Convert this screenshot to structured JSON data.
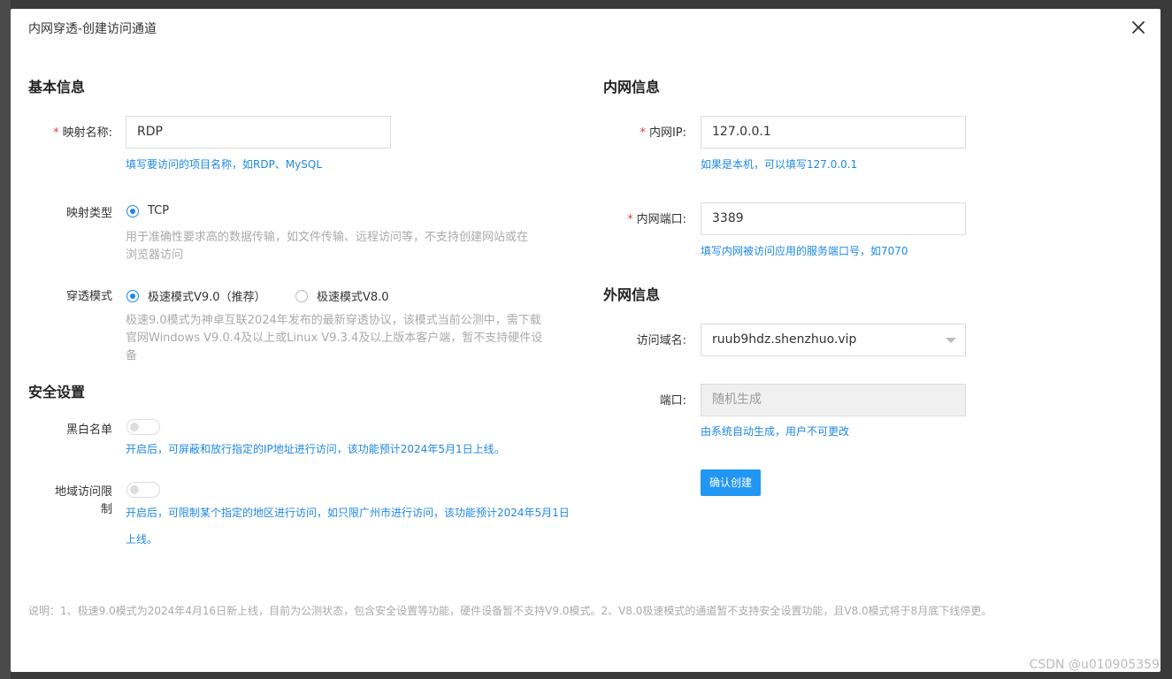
{
  "dialog": {
    "title": "内网穿透-创建访问通道"
  },
  "basic": {
    "section_title": "基本信息",
    "mapping_name_label": "映射名称:",
    "mapping_name_value": "RDP",
    "mapping_name_hint": "填写要访问的项目名称，如RDP、MySQL",
    "mapping_type_label": "映射类型",
    "mapping_type_option": "TCP",
    "mapping_type_desc_line1": "用于准确性要求高的数据传输，如文件传输、远程访问等，不支持创建网站或在",
    "mapping_type_desc_line2": "浏览器访问",
    "mode_label": "穿透模式",
    "mode_option_1": "极速模式V9.0（推荐）",
    "mode_option_2": "极速模式V8.0",
    "mode_selected": "极速模式V9.0（推荐）",
    "mode_desc_line1": "极速9.0模式为神卓互联2024年发布的最新穿透协议，该模式当前公测中，需下载",
    "mode_desc_line2": "官网Windows V9.0.4及以上或Linux V9.3.4及以上版本客户端，暂不支持硬件设",
    "mode_desc_line3": "备"
  },
  "security": {
    "section_title": "安全设置",
    "whitelist_label": "黑白名单",
    "whitelist_enabled": false,
    "whitelist_hint": "开启后，可屏蔽和放行指定的IP地址进行访问，该功能预计2024年5月1日上线。",
    "geo_label_line1": "地域访问限",
    "geo_label_line2": "制",
    "geo_enabled": false,
    "geo_hint_line1": "开启后，可限制某个指定的地区进行访问，如只限广州市进行访问，该功能预计2024年5月1日",
    "geo_hint_line2": "上线。"
  },
  "intranet": {
    "section_title": "内网信息",
    "ip_label": "内网IP:",
    "ip_value": "127.0.0.1",
    "ip_hint": "如果是本机，可以填写127.0.0.1",
    "port_label": "内网端口:",
    "port_value": "3389",
    "port_hint": "填写内网被访问应用的服务端口号，如7070"
  },
  "extranet": {
    "section_title": "外网信息",
    "domain_label": "访问域名:",
    "domain_value": "ruub9hdz.shenzhuo.vip",
    "port_label": "端口:",
    "port_placeholder": "随机生成",
    "port_hint": "由系统自动生成，用户不可更改",
    "confirm_label": "确认创建"
  },
  "footer": {
    "note": "说明：1、极速9.0模式为2024年4月16日新上线，目前为公测状态，包含安全设置等功能，硬件设备暂不支持V9.0模式。2、V8.0极速模式的通道暂不支持安全设置功能，且V8.0模式将于8月底下线停更。"
  },
  "watermark": "CSDN @u010905359",
  "colors": {
    "accent": "#2196f3",
    "hint": "#1e88e5",
    "required": "#e53935"
  }
}
